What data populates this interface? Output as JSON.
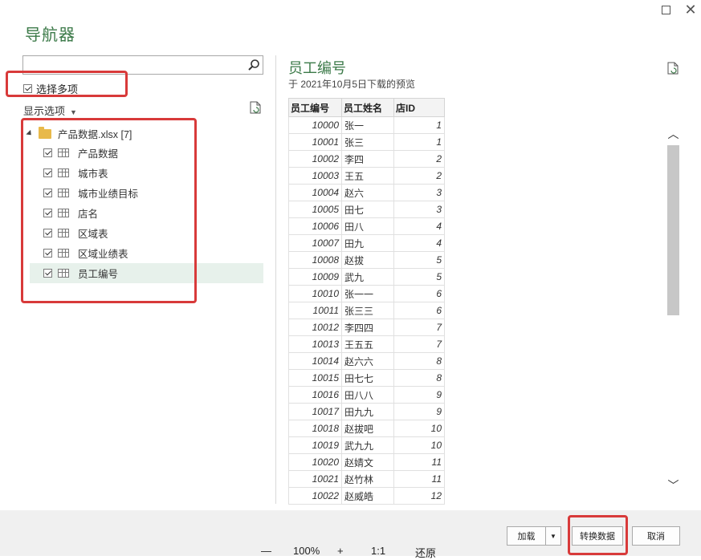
{
  "window": {
    "maximize_icon": "maximize-icon",
    "close_symbol": "✕"
  },
  "title": "导航器",
  "search": {
    "value": "",
    "placeholder": ""
  },
  "select_multiple_label": "选择多项",
  "display_options_label": "显示选项",
  "tree": {
    "root_label": "产品数据.xlsx [7]",
    "items": [
      {
        "label": "产品数据",
        "checked": true
      },
      {
        "label": "城市表",
        "checked": true
      },
      {
        "label": "城市业绩目标",
        "checked": true
      },
      {
        "label": "店名",
        "checked": true
      },
      {
        "label": "区域表",
        "checked": true
      },
      {
        "label": "区域业绩表",
        "checked": true
      },
      {
        "label": "员工编号",
        "checked": true,
        "selected": true
      }
    ]
  },
  "preview": {
    "title": "员工编号",
    "subtitle": "于 2021年10月5日下载的预览",
    "columns": [
      "员工编号",
      "员工姓名",
      "店ID"
    ],
    "rows": [
      [
        "10000",
        "张一",
        "1"
      ],
      [
        "10001",
        "张三",
        "1"
      ],
      [
        "10002",
        "李四",
        "2"
      ],
      [
        "10003",
        "王五",
        "2"
      ],
      [
        "10004",
        "赵六",
        "3"
      ],
      [
        "10005",
        "田七",
        "3"
      ],
      [
        "10006",
        "田八",
        "4"
      ],
      [
        "10007",
        "田九",
        "4"
      ],
      [
        "10008",
        "赵拔",
        "5"
      ],
      [
        "10009",
        "武九",
        "5"
      ],
      [
        "10010",
        "张一一",
        "6"
      ],
      [
        "10011",
        "张三三",
        "6"
      ],
      [
        "10012",
        "李四四",
        "7"
      ],
      [
        "10013",
        "王五五",
        "7"
      ],
      [
        "10014",
        "赵六六",
        "8"
      ],
      [
        "10015",
        "田七七",
        "8"
      ],
      [
        "10016",
        "田八八",
        "9"
      ],
      [
        "10017",
        "田九九",
        "9"
      ],
      [
        "10018",
        "赵拔吧",
        "10"
      ],
      [
        "10019",
        "武九九",
        "10"
      ],
      [
        "10020",
        "赵婧文",
        "11"
      ],
      [
        "10021",
        "赵竹林",
        "11"
      ],
      [
        "10022",
        "赵威皓",
        "12"
      ]
    ]
  },
  "footer": {
    "load_label": "加载",
    "load_dropdown": "▼",
    "transform_label": "转换数据",
    "cancel_label": "取消",
    "zoom_minus": "—",
    "zoom_level": "100%",
    "zoom_plus": "+",
    "zoom_ratio": "1:1",
    "zoom_reset": "还原"
  },
  "colors": {
    "accent": "#3c7a49",
    "highlight": "#d83a3a",
    "selected_row": "#e7f1eb"
  }
}
